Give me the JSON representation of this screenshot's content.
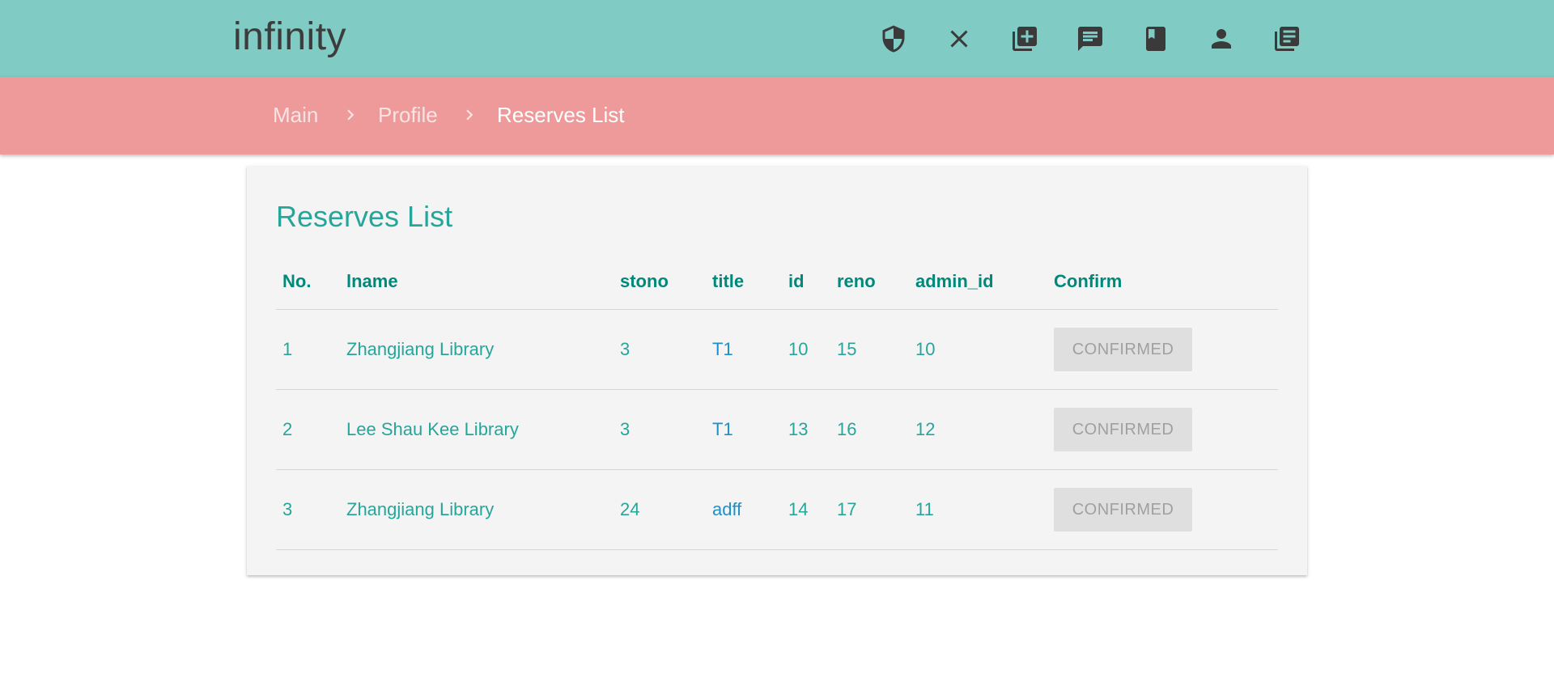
{
  "app": {
    "brand": "infinity"
  },
  "nav": {
    "icons": [
      {
        "name": "shield-icon"
      },
      {
        "name": "close-icon"
      },
      {
        "name": "add-library-icon"
      },
      {
        "name": "message-icon"
      },
      {
        "name": "book-icon"
      },
      {
        "name": "person-icon"
      },
      {
        "name": "library-books-icon"
      }
    ]
  },
  "breadcrumb": {
    "items": [
      "Main",
      "Profile",
      "Reserves List"
    ]
  },
  "card": {
    "title": "Reserves List",
    "columns": [
      "No.",
      "lname",
      "stono",
      "title",
      "id",
      "reno",
      "admin_id",
      "Confirm"
    ],
    "rows": [
      {
        "no": "1",
        "lname": "Zhangjiang Library",
        "stono": "3",
        "title": "T1",
        "id": "10",
        "reno": "15",
        "admin_id": "10",
        "confirm": "CONFIRMED"
      },
      {
        "no": "2",
        "lname": "Lee Shau Kee Library",
        "stono": "3",
        "title": "T1",
        "id": "13",
        "reno": "16",
        "admin_id": "12",
        "confirm": "CONFIRMED"
      },
      {
        "no": "3",
        "lname": "Zhangjiang Library",
        "stono": "24",
        "title": "adff",
        "id": "14",
        "reno": "17",
        "admin_id": "11",
        "confirm": "CONFIRMED"
      }
    ]
  },
  "colors": {
    "topbar": "#80cbc4",
    "crumbbar": "#ef9a9a",
    "accent": "#26a69a",
    "link": "#1e90c8"
  }
}
